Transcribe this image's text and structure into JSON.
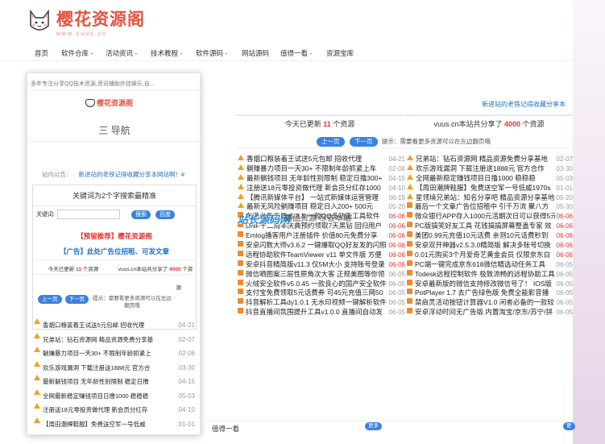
{
  "site": {
    "title": "樱花资源阁",
    "subtitle": "www.vuus.cn"
  },
  "nav": [
    "首页",
    "软件仓库 -",
    "活动资讯 -",
    "技术教程 -",
    "软件源码 -",
    "网站源码",
    "值得一看 -",
    "资源宝库"
  ],
  "notice_right": "新进站的老铁记得收藏分享本",
  "panel_left": {
    "prefix": "今天已更新 ",
    "count": "11",
    "suffix": " 个资源"
  },
  "panel_right": {
    "prefix": "vuus.cn本站共分享了 ",
    "count": "4000",
    "suffix": " 个资源"
  },
  "pager": {
    "prev": "上一页",
    "next": "下一页",
    "hint": "提示：需要看更多资源可以在左边翻页哦"
  },
  "watermark": "站长源码网",
  "watermark_overlay": "精品资源 尽在本站",
  "col_left": [
    {
      "i": "c",
      "t": "香烟口粮装着王试送5元包邮 招收代理",
      "d": "04-21"
    },
    {
      "i": "c",
      "t": "躺赚暴力项目一天30+ 不限制年龄抓紧上车",
      "d": "02-06"
    },
    {
      "i": "c",
      "t": "最新躺钱项目 无年龄性别限制 稳定日撸300+",
      "d": "04-15"
    },
    {
      "i": "c",
      "t": "注册送18元零投资做代理 新会员分红存1000",
      "d": "04-10"
    },
    {
      "i": "c",
      "t": "【腾讯新媒体平台】 一站式新媒体运营管理",
      "d": "06-19"
    },
    {
      "i": "c",
      "t": "最新无风险躺赚项目 稳定日入200+ 500元",
      "d": "05-20"
    },
    {
      "i": "o",
      "t": "布满必备工具v5.8.5 一款QQ多功能工具软件",
      "d": "06-06"
    },
    {
      "i": "o",
      "t": "DNF十二周年庆典预约领取7天黑钻 回归用户",
      "d": "06-06"
    },
    {
      "i": "o",
      "t": "Emlog播客用户注册插件 价值80元免费分享",
      "d": "06-06"
    },
    {
      "i": "o",
      "t": "安卓闪数大师v3.6.2 一键爆取QQ好友发的闪照",
      "d": "06-06"
    },
    {
      "i": "o",
      "t": "远程协助软件TeamViewer v11 单文件版 方便",
      "d": "06-06"
    },
    {
      "i": "o",
      "t": "安卓抖音精简版v11.3 仅5M大小 支持账号登录",
      "d": "06-06"
    },
    {
      "i": "o",
      "t": "微信晒图案三层性原角次大客 正规美图等你领",
      "d": "06-05"
    },
    {
      "i": "o",
      "t": "火绒安全软件v5.0.45 一款良心的国产安全软件",
      "d": "06-05"
    },
    {
      "i": "o",
      "t": "支付宝免费领取5元话费券 可45元充值三网50",
      "d": "06-05"
    },
    {
      "i": "o",
      "t": "抖音解析工具dy1.0.1 无水印视频一键解析软件",
      "d": "06-05"
    },
    {
      "i": "o",
      "t": "抖音直播间氛围提升工具v1.0.0 直播间自动发",
      "d": "06-05"
    }
  ],
  "col_right": [
    {
      "i": "c",
      "t": "兄弟站：钻石资源网 精品资源免费分享基地",
      "d": "02-07"
    },
    {
      "i": "c",
      "t": "欢乐游戏漏洞 下载注册送1888元 官方合作",
      "d": "03-30"
    },
    {
      "i": "c",
      "t": "全网最新稳定赚钱项目日撸1000 稳稳稳",
      "d": "05-03"
    },
    {
      "i": "c",
      "t": "【周田潮牌鞋服】免费送空军一号低威1970s",
      "d": "01-01"
    },
    {
      "i": "c",
      "t": "星领境兄弟站：知名分享吧 精品资源分享基地",
      "d": "05-20"
    },
    {
      "i": "o",
      "t": "最后一个文章广告位招租中 引千万流 聚八方",
      "d": "05-30"
    },
    {
      "i": "o",
      "t": "微众银行APP存入1000元活期次日可以获得5元",
      "d": "06-06"
    },
    {
      "i": "o",
      "t": "PC版搞笑好友工具 花钱搞搞屏幕整蛊专家 效",
      "d": "06-06"
    },
    {
      "i": "o",
      "t": "美团0.99元充值10元话费 亲测10元话费秒到",
      "d": "06-06"
    },
    {
      "i": "o",
      "t": "安卓双开神器v2.5.3.0精简版 解决多账号切换",
      "d": "06-06"
    },
    {
      "i": "o",
      "t": "0.01元购买3个月爱奇艺黄金会员 仅限京东白",
      "d": "06-06"
    },
    {
      "i": "o",
      "t": "PC端一键完成京东618微信精选动任务工具",
      "d": "06-05"
    },
    {
      "i": "o",
      "t": "Todesk远程控制软件 极致流畅的远程协助工具",
      "d": "06-05"
    },
    {
      "i": "o",
      "t": "安卓最新版的微信支持修改微信号了！ IOS版",
      "d": "06-05"
    },
    {
      "i": "o",
      "t": "PotPlayer 1.7 去广告绿色版 免费全能影音播",
      "d": "06-05"
    },
    {
      "i": "o",
      "t": "禁启灵活动按钮计算器V1.0 闲者必备的一款较",
      "d": "06-05"
    },
    {
      "i": "o",
      "t": "安卓浮动时间无广告版 内置淘宝/京东/苏宁/拼",
      "d": "06-05"
    }
  ],
  "popup": {
    "top_text": "多年专注分享QQ技术资源,资讯辅助外挂娱乐,自...",
    "mini_logo": "樱花资源阁",
    "nav_title": "三 导航",
    "site_notice_label": "站内公告：",
    "site_notice": "新进站的老铁记得收藏分享本网站啊！#",
    "search_title": "关键词为2个字搜索最精准",
    "kw_label": "关键词:",
    "search_btn": "搜索",
    "baidu_btn": "百度",
    "ad1": "【预留推荐】樱花资源阁",
    "ad2": "【广告】此处广告位招租、可发文章",
    "mini_today_prefix": "今天已更新 ",
    "mini_today_count": "11",
    "mini_today_suffix": " 个资源",
    "mini_total_prefix": "vuus.cn本站共分享了 ",
    "mini_total_count": "4000",
    "mini_total_suffix": " 个资",
    "mini_source": "源",
    "mini_hint": "提示：需要看更多资源可以在左边翻页哦",
    "items": [
      {
        "i": "c",
        "t": "香烟口粮装着王试送5元包邮 招收代理",
        "d": "04-21"
      },
      {
        "i": "c",
        "t": "兄弟站：钻石资源网 精品资源免费分享基",
        "d": "02-07"
      },
      {
        "i": "c",
        "t": "躺赚暴力项目一天30+ 不限制年龄抓紧上",
        "d": "02-06"
      },
      {
        "i": "c",
        "t": "欢乐游戏漏洞 下载注册送1888元 官方合",
        "d": "03-30"
      },
      {
        "i": "c",
        "t": "最新躺钱项目 无年龄性别限制 稳定日撸",
        "d": "04-15"
      },
      {
        "i": "c",
        "t": "全网最新稳定赚钱项目日撸1000 稳稳稳",
        "d": "05-03"
      },
      {
        "i": "c",
        "t": "注册送18元零投资做代理 新会员分红存",
        "d": "04-10"
      },
      {
        "i": "c",
        "t": "【周田潮牌鞋服】免费送空军一号低威",
        "d": "01-01"
      }
    ]
  },
  "bottom_bar": {
    "title": "值得一看",
    "more": "更多"
  }
}
